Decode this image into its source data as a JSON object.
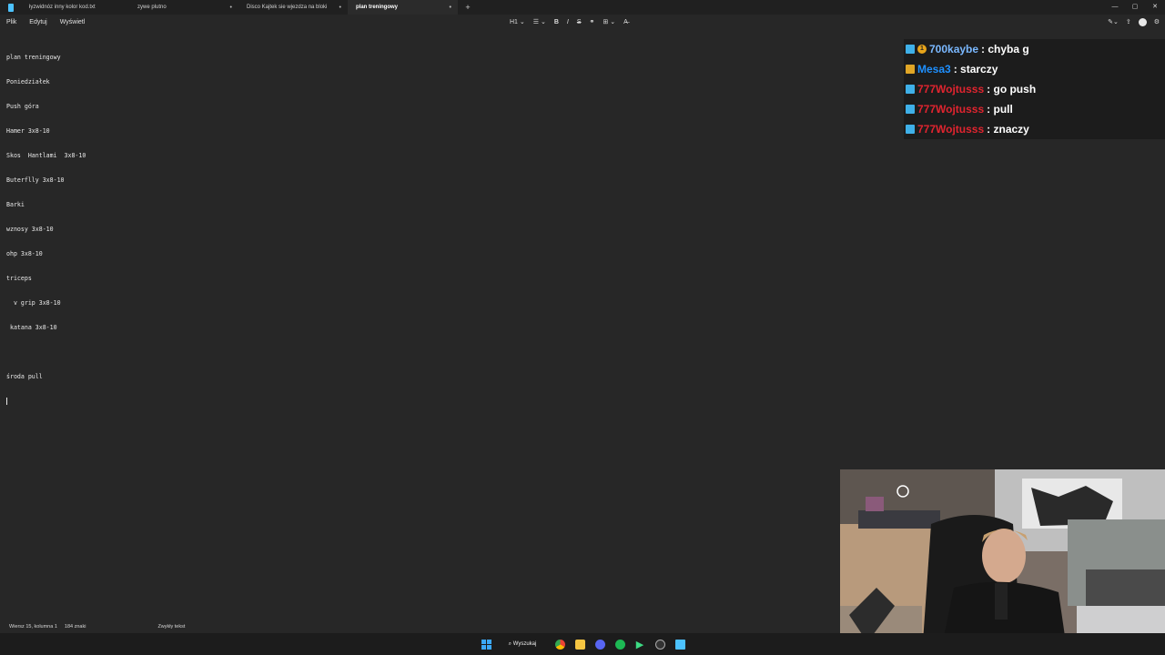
{
  "tabs": [
    {
      "title": "łyzwidnóz inny kolor  kod.txt",
      "marker": ""
    },
    {
      "title": "zywe plutno",
      "marker": "•"
    },
    {
      "title": "Disco Kajtek sie wjezdza na bloki",
      "marker": "•"
    },
    {
      "title": "plan treningowy",
      "marker": "•",
      "active": true
    }
  ],
  "new_tab": "+",
  "window_controls": {
    "minimize": "—",
    "maximize": "▢",
    "close": "✕"
  },
  "menu": {
    "file": "Plik",
    "edit": "Edytuj",
    "view": "Wyświetl"
  },
  "format_toolbar": {
    "heading": "H1 ⌄",
    "list": "☰ ⌄",
    "bold": "B",
    "italic": "I",
    "strike": "S",
    "link": "⚭",
    "table": "⊞ ⌄",
    "clear": "A̶"
  },
  "editor_lines": [
    "plan treningowy",
    "Poniedziałek",
    "Push góra",
    "Hamer 3x8-10",
    "Skos  Hantlami  3x8-10",
    "Buterflly 3x8-10",
    "Barki",
    "wznosy 3x8-10",
    "ohp 3x8-10",
    "triceps",
    "  v grip 3x8-10",
    " katana 3x8-10",
    "",
    "środa pull"
  ],
  "status": {
    "position": "Wiersz 15, kolumna 1",
    "chars": "184 znaki",
    "style": "Zwykły tekst"
  },
  "taskbar": {
    "search": "Wyszukaj"
  },
  "chat": [
    {
      "user": "700kaybe",
      "message": ": chyba g",
      "color": "#7ab8ff",
      "badges": [
        "prime",
        "one"
      ]
    },
    {
      "user": "Mesa3",
      "message": ": starczy",
      "color": "#1e90ff",
      "badges": [
        "sub"
      ]
    },
    {
      "user": "777Wojtusss",
      "message": ": go push",
      "color": "#e0242f",
      "badges": [
        "prime"
      ]
    },
    {
      "user": "777Wojtusss",
      "message": ": pull",
      "color": "#e0242f",
      "badges": [
        "prime"
      ]
    },
    {
      "user": "777Wojtusss",
      "message": ": znaczy",
      "color": "#e0242f",
      "badges": [
        "prime"
      ]
    }
  ]
}
